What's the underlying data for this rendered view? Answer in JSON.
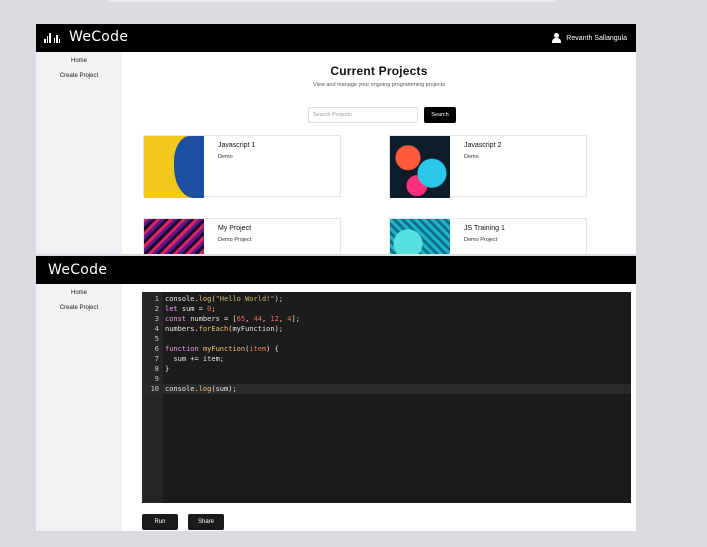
{
  "app": {
    "brand": "WeCode",
    "user_name": "Revanth Sallangula"
  },
  "sidebar": {
    "items": [
      {
        "label": "Home"
      },
      {
        "label": "Create Project"
      }
    ]
  },
  "projects_page": {
    "title": "Current Projects",
    "subtitle": "View and manage your ongoing programming projects",
    "search": {
      "placeholder": "Search Projects",
      "value": "",
      "button_label": "Search"
    },
    "projects": [
      {
        "title": "Javascript 1",
        "description": "Demo",
        "thumbnail": "yellow-blue-abstract"
      },
      {
        "title": "Javascript 2",
        "description": "Demo",
        "thumbnail": "colorful-abstract"
      },
      {
        "title": "My Project",
        "description": "Demo Project",
        "thumbnail": "red-purple-waves"
      },
      {
        "title": "JS Training 1",
        "description": "Demo Project",
        "thumbnail": "teal-waves"
      }
    ]
  },
  "editor_page": {
    "code_lines": [
      {
        "n": "1",
        "text": "console.log(\"Hello World!\");"
      },
      {
        "n": "2",
        "text": "let sum = 0;"
      },
      {
        "n": "3",
        "text": "const numbers = [65, 44, 12, 4];"
      },
      {
        "n": "4",
        "text": "numbers.forEach(myFunction);"
      },
      {
        "n": "5",
        "text": ""
      },
      {
        "n": "6",
        "text": "function myFunction(item) {"
      },
      {
        "n": "7",
        "text": "  sum += item;"
      },
      {
        "n": "8",
        "text": "}"
      },
      {
        "n": "9",
        "text": ""
      },
      {
        "n": "10",
        "text": "console.log(sum);"
      }
    ],
    "active_line": 10,
    "run_label": "Run",
    "share_label": "Share"
  },
  "colors": {
    "topbar": "#000000",
    "sidebar": "#f1f0f3",
    "editor_bg": "#1b1b1b",
    "button": "#000000"
  }
}
